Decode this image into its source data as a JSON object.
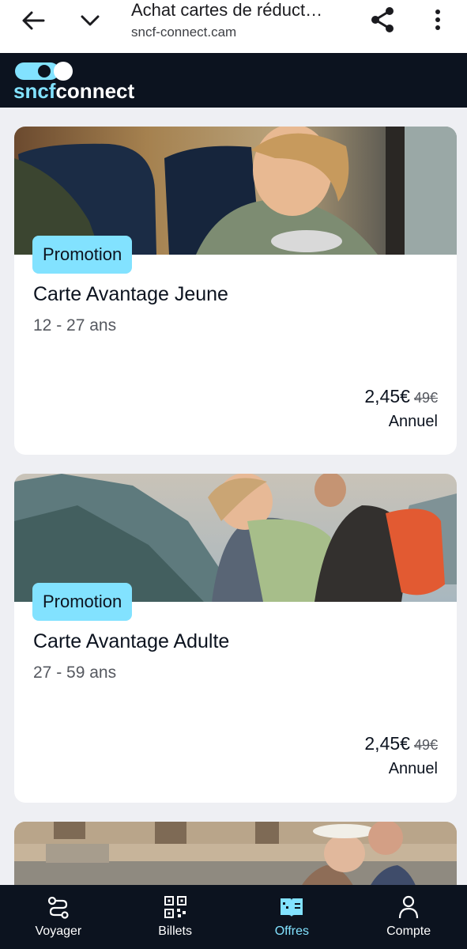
{
  "browser": {
    "title": "Achat cartes de réduct…",
    "url": "sncf-connect.cam",
    "back_icon": "arrow-left-icon",
    "dropdown_icon": "chevron-down-icon",
    "share_icon": "share-icon",
    "more_icon": "more-vertical-icon"
  },
  "app": {
    "logo_part1": "sncf",
    "logo_part2": "connect",
    "brand_color": "#82e2ff",
    "header_bg": "#0c131f"
  },
  "cards": [
    {
      "badge": "Promotion",
      "title": "Carte Avantage Jeune",
      "age": "12 - 27 ans",
      "price": "2,45€",
      "old_price": "49€",
      "period": "Annuel"
    },
    {
      "badge": "Promotion",
      "title": "Carte Avantage Adulte",
      "age": "27 - 59 ans",
      "price": "2,45€",
      "old_price": "49€",
      "period": "Annuel"
    }
  ],
  "nav": {
    "items": [
      {
        "label": "Voyager",
        "icon": "route-icon",
        "active": false
      },
      {
        "label": "Billets",
        "icon": "qr-code-icon",
        "active": false
      },
      {
        "label": "Offres",
        "icon": "offers-icon",
        "active": true
      },
      {
        "label": "Compte",
        "icon": "account-icon",
        "active": false
      }
    ]
  }
}
